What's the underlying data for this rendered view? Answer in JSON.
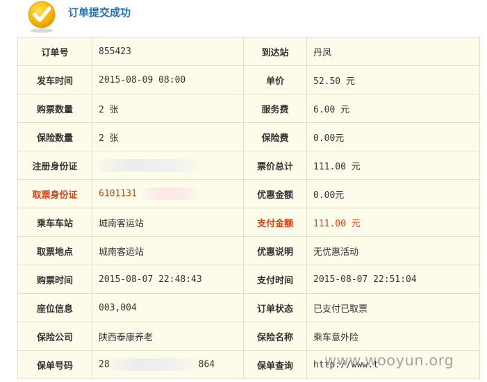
{
  "header": {
    "title": "订单提交成功",
    "icon": "check-badge-icon",
    "accent": "#1e73be"
  },
  "colors": {
    "highlight": "#d7410e",
    "table_bg": "#fdfbea",
    "border": "#e2dfc2"
  },
  "rows": [
    {
      "l1": "订单号",
      "v1": "855423",
      "l2": "到达站",
      "v2": "丹凤"
    },
    {
      "l1": "发车时间",
      "v1": "2015-08-09 08:00",
      "l2": "单价",
      "v2": "52.50 元"
    },
    {
      "l1": "购票数量",
      "v1": "2 张",
      "l2": "服务费",
      "v2": "6.00 元"
    },
    {
      "l1": "保险数量",
      "v1": "2 张",
      "l2": "保险费",
      "v2": "0.00元"
    },
    {
      "l1": "注册身份证",
      "v1": "",
      "l2": "票价总计",
      "v2": "111.00 元"
    },
    {
      "l1": "取票身份证",
      "v1": "6101131",
      "l2": "优惠金额",
      "v2": "0.00元"
    },
    {
      "l1": "乘车车站",
      "v1": "城南客运站",
      "l2": "支付金额",
      "v2": "111.00 元"
    },
    {
      "l1": "取票地点",
      "v1": "城南客运站",
      "l2": "优惠说明",
      "v2": "无优惠活动"
    },
    {
      "l1": "购票时间",
      "v1": "2015-08-07 22:48:43",
      "l2": "支付时间",
      "v2": "2015-08-07 22:51:04"
    },
    {
      "l1": "座位信息",
      "v1": "003,004",
      "l2": "订单状态",
      "v2": "已支付已取票"
    },
    {
      "l1": "保险公司",
      "v1": "陕西泰康养老",
      "l2": "保险名称",
      "v2": "乘车意外险"
    },
    {
      "l1": "保单号码",
      "v1": "28",
      "v1_tail": "864",
      "l2": "保单查询",
      "v2": "http://www.t"
    }
  ],
  "watermark": "www.wooyun.org"
}
